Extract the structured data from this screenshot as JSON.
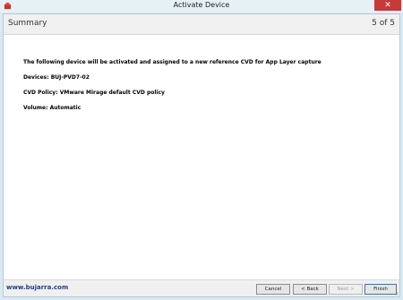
{
  "window": {
    "title": "Activate Device",
    "close_glyph": "✕"
  },
  "header": {
    "title": "Summary",
    "step": "5 of 5"
  },
  "summary": {
    "intro": "The following device will be activated and assigned to a new reference CVD for App Layer capture",
    "devices": "Devices: BUJ-PVD7-02",
    "cvd_policy": "CVD Policy: VMware Mirage default CVD policy",
    "volume": "Volume: Automatic"
  },
  "footer": {
    "watermark": "www.bujarra.com",
    "cancel_label": "Cancel",
    "back_label": "< Back",
    "next_label": "Next >",
    "finish_label": "Finish"
  },
  "colors": {
    "accent": "#c73a3a",
    "watermark": "#1f3f82"
  }
}
